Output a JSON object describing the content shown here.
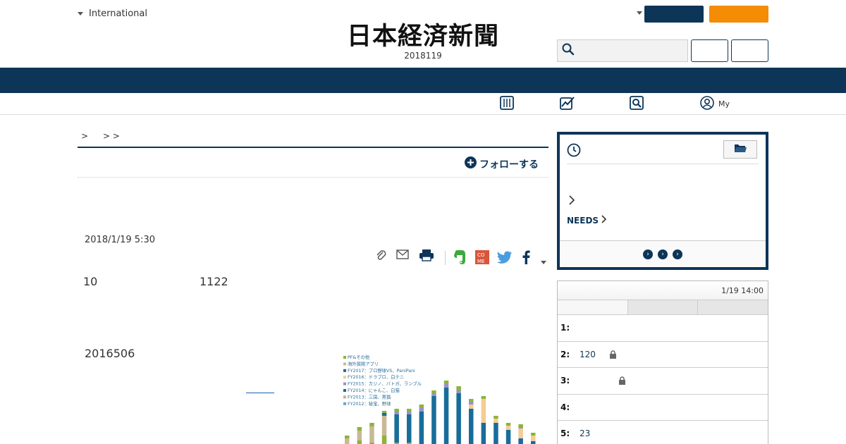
{
  "header": {
    "region_label": "International",
    "logo_text": "日本経済新聞",
    "date_stamp": "2018119",
    "search": {
      "value": "",
      "placeholder": ""
    }
  },
  "subnav": {
    "items": [
      {
        "icon": "newspaper-icon",
        "label": ""
      },
      {
        "icon": "chart-pen-icon",
        "label": ""
      },
      {
        "icon": "search-icon",
        "label": ""
      },
      {
        "icon": "user-icon",
        "label": "My"
      }
    ]
  },
  "breadcrumb": {
    "sep1": ">",
    "sep2": "> >"
  },
  "article": {
    "follow_label": "フォローする",
    "published": "2018/1/19 5:30",
    "line1_left": "10",
    "line1_right": "1122",
    "line2": "2016506",
    "share_icons": [
      "clip-icon",
      "mail-icon",
      "print-icon",
      "evernote-icon",
      "comemo-icon",
      "twitter-icon",
      "facebook-icon",
      "more-caret-icon"
    ]
  },
  "chart_data": {
    "type": "bar",
    "stacked": true,
    "legend_position": "top-left",
    "series": [
      {
        "name": "PF&その他",
        "color": "#8db33a"
      },
      {
        "name": "海外展開アプリ",
        "color": "#c9b896"
      },
      {
        "name": "FY2017：プロ野球VS、PaniPani",
        "color": "#1a6aa1"
      },
      {
        "name": "FY2016：ドラプロ、白テニ",
        "color": "#f5cc92"
      },
      {
        "name": "FY2015：カジノ、バトガ、ランブル",
        "color": "#9a92c0"
      },
      {
        "name": "FY2014：にゃんこ、白猫",
        "color": "#176d9a"
      },
      {
        "name": "FY2013：三国、黒猫",
        "color": "#bfb38a"
      },
      {
        "name": "FY2012：秘宝、野球",
        "color": "#5fa9cf"
      }
    ],
    "bars": [
      [
        [
          1,
          8
        ],
        [
          0,
          4
        ]
      ],
      [
        [
          0,
          5
        ],
        [
          1,
          14
        ],
        [
          0,
          5
        ]
      ],
      [
        [
          0,
          2
        ],
        [
          1,
          23
        ],
        [
          0,
          5
        ]
      ],
      [
        [
          0,
          12
        ],
        [
          1,
          28
        ],
        [
          5,
          4
        ],
        [
          0,
          3
        ]
      ],
      [
        [
          0,
          2
        ],
        [
          5,
          40
        ],
        [
          4,
          4
        ],
        [
          0,
          4
        ]
      ],
      [
        [
          0,
          2
        ],
        [
          5,
          40
        ],
        [
          4,
          4
        ],
        [
          0,
          4
        ]
      ],
      [
        [
          5,
          46
        ],
        [
          4,
          6
        ],
        [
          0,
          4
        ]
      ],
      [
        [
          5,
          68
        ],
        [
          4,
          4
        ],
        [
          0,
          4
        ]
      ],
      [
        [
          5,
          80
        ],
        [
          4,
          6
        ],
        [
          0,
          4
        ]
      ],
      [
        [
          5,
          72
        ],
        [
          4,
          4
        ],
        [
          0,
          6
        ]
      ],
      [
        [
          5,
          50
        ],
        [
          3,
          6
        ],
        [
          4,
          4
        ],
        [
          0,
          4
        ]
      ],
      [
        [
          2,
          8
        ],
        [
          5,
          22
        ],
        [
          3,
          34
        ],
        [
          0,
          4
        ]
      ],
      [
        [
          2,
          6
        ],
        [
          5,
          24
        ],
        [
          3,
          6
        ],
        [
          0,
          4
        ]
      ],
      [
        [
          2,
          10
        ],
        [
          5,
          10
        ],
        [
          3,
          6
        ],
        [
          0,
          4
        ]
      ],
      [
        [
          2,
          8
        ],
        [
          3,
          14
        ],
        [
          4,
          2
        ],
        [
          0,
          4
        ]
      ],
      [
        [
          2,
          4
        ],
        [
          3,
          8
        ],
        [
          0,
          4
        ]
      ],
      [
        [
          2,
          6
        ],
        [
          5,
          14
        ],
        [
          4,
          4
        ],
        [
          0,
          6
        ]
      ]
    ]
  },
  "sidebar": {
    "history": {
      "needs_label": "NEEDS",
      "footer_arrows": [
        "›",
        "›",
        "›"
      ]
    },
    "ranking": {
      "timestamp": "1/19 14:00",
      "rows": [
        {
          "num": "1:",
          "text": "",
          "locked": false
        },
        {
          "num": "2:",
          "text": "120",
          "locked": true
        },
        {
          "num": "3:",
          "text": "",
          "locked": true
        },
        {
          "num": "4:",
          "text": "",
          "locked": false
        },
        {
          "num": "5:",
          "text": "23",
          "locked": false
        }
      ]
    }
  },
  "colors": {
    "navy": "#0d3558",
    "orange": "#f48c06"
  }
}
